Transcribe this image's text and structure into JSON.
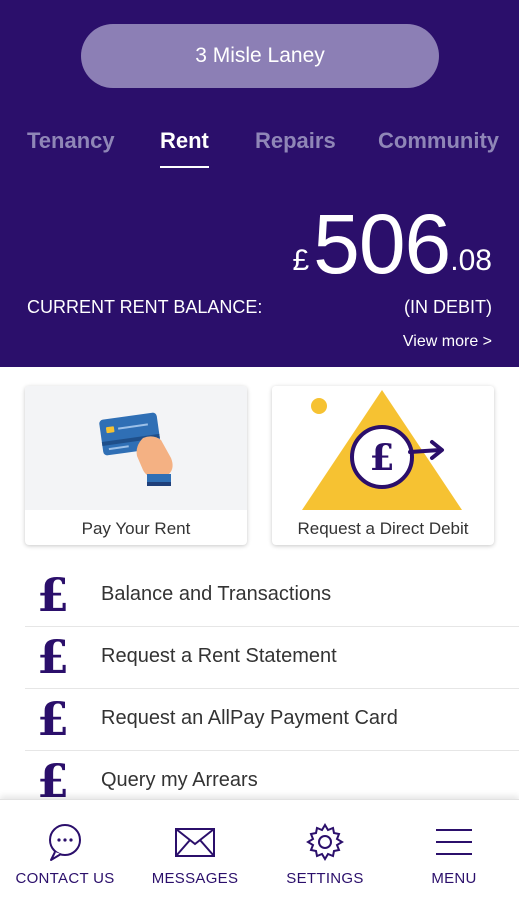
{
  "header": {
    "address": "3 Misle Laney",
    "tabs": [
      {
        "label": "Tenancy",
        "active": false
      },
      {
        "label": "Rent",
        "active": true
      },
      {
        "label": "Repairs",
        "active": false
      },
      {
        "label": "Community",
        "active": false
      }
    ],
    "balance": {
      "currency": "£",
      "whole": "506",
      "decimal": ".08",
      "label": "CURRENT RENT BALANCE:",
      "status": "(IN DEBIT)",
      "view_more": "View more >"
    }
  },
  "cards": [
    {
      "label": "Pay Your Rent",
      "icon": "card-payment-icon"
    },
    {
      "label": "Request a Direct Debit",
      "icon": "direct-debit-icon"
    }
  ],
  "list": [
    {
      "label": "Balance and Transactions",
      "icon": "pound",
      "glyph": "£"
    },
    {
      "label": "Request a Rent Statement",
      "icon": "pound",
      "glyph": "£"
    },
    {
      "label": "Request an AllPay Payment Card",
      "icon": "pound",
      "glyph": "£"
    },
    {
      "label": "Query my Arrears",
      "icon": "pound",
      "glyph": "£"
    }
  ],
  "bottom_nav": [
    {
      "label": "CONTACT US",
      "icon": "chat-bubble-icon"
    },
    {
      "label": "MESSAGES",
      "icon": "envelope-icon"
    },
    {
      "label": "SETTINGS",
      "icon": "gear-icon"
    },
    {
      "label": "MENU",
      "icon": "hamburger-icon"
    }
  ],
  "colors": {
    "brand": "#2b0f6b",
    "pill": "#8c7fb5",
    "tab_inactive": "#8f86b7",
    "accent_yellow": "#f6c232"
  }
}
